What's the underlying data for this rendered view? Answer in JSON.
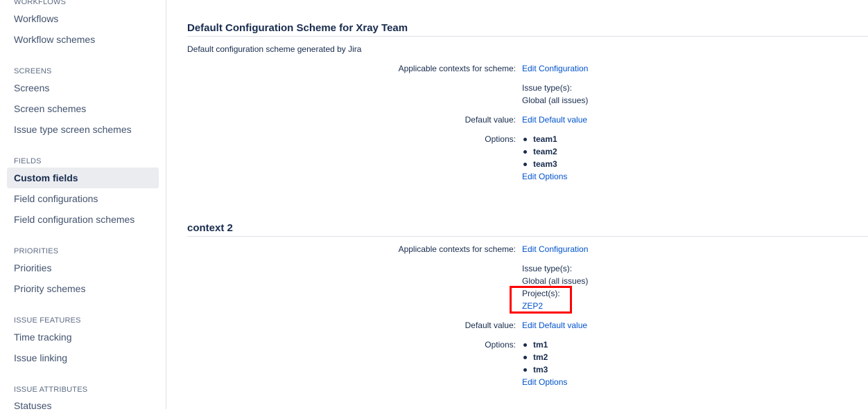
{
  "sidebar": {
    "sections": [
      {
        "heading": "WORKFLOWS",
        "items": [
          "Workflows",
          "Workflow schemes"
        ]
      },
      {
        "heading": "SCREENS",
        "items": [
          "Screens",
          "Screen schemes",
          "Issue type screen schemes"
        ]
      },
      {
        "heading": "FIELDS",
        "items": [
          "Custom fields",
          "Field configurations",
          "Field configuration schemes"
        ]
      },
      {
        "heading": "PRIORITIES",
        "items": [
          "Priorities",
          "Priority schemes"
        ]
      },
      {
        "heading": "ISSUE FEATURES",
        "items": [
          "Time tracking",
          "Issue linking"
        ]
      },
      {
        "heading": "ISSUE ATTRIBUTES",
        "items": [
          "Statuses"
        ]
      }
    ],
    "active_item": "Custom fields"
  },
  "contexts": [
    {
      "title": "Default Configuration Scheme for Xray Team",
      "description": "Default configuration scheme generated by Jira",
      "applicable_label": "Applicable contexts for scheme:",
      "edit_configuration": "Edit Configuration",
      "issue_types_label": "Issue type(s):",
      "issue_types_value": "Global (all issues)",
      "default_value_label": "Default value:",
      "edit_default_value": "Edit Default value",
      "options_label": "Options:",
      "options": [
        "team1",
        "team2",
        "team3"
      ],
      "edit_options": "Edit Options"
    },
    {
      "title": "context 2",
      "applicable_label": "Applicable contexts for scheme:",
      "edit_configuration": "Edit Configuration",
      "issue_types_label": "Issue type(s):",
      "issue_types_value": "Global (all issues)",
      "projects_label": "Project(s):",
      "projects_value": "ZEP2",
      "default_value_label": "Default value:",
      "edit_default_value": "Edit Default value",
      "options_label": "Options:",
      "options": [
        "tm1",
        "tm2",
        "tm3"
      ],
      "edit_options": "Edit Options"
    }
  ],
  "colors": {
    "link": "#0052cc",
    "text": "#172b4d",
    "highlight": "#ff0000",
    "active_bg": "#ebecf0"
  }
}
